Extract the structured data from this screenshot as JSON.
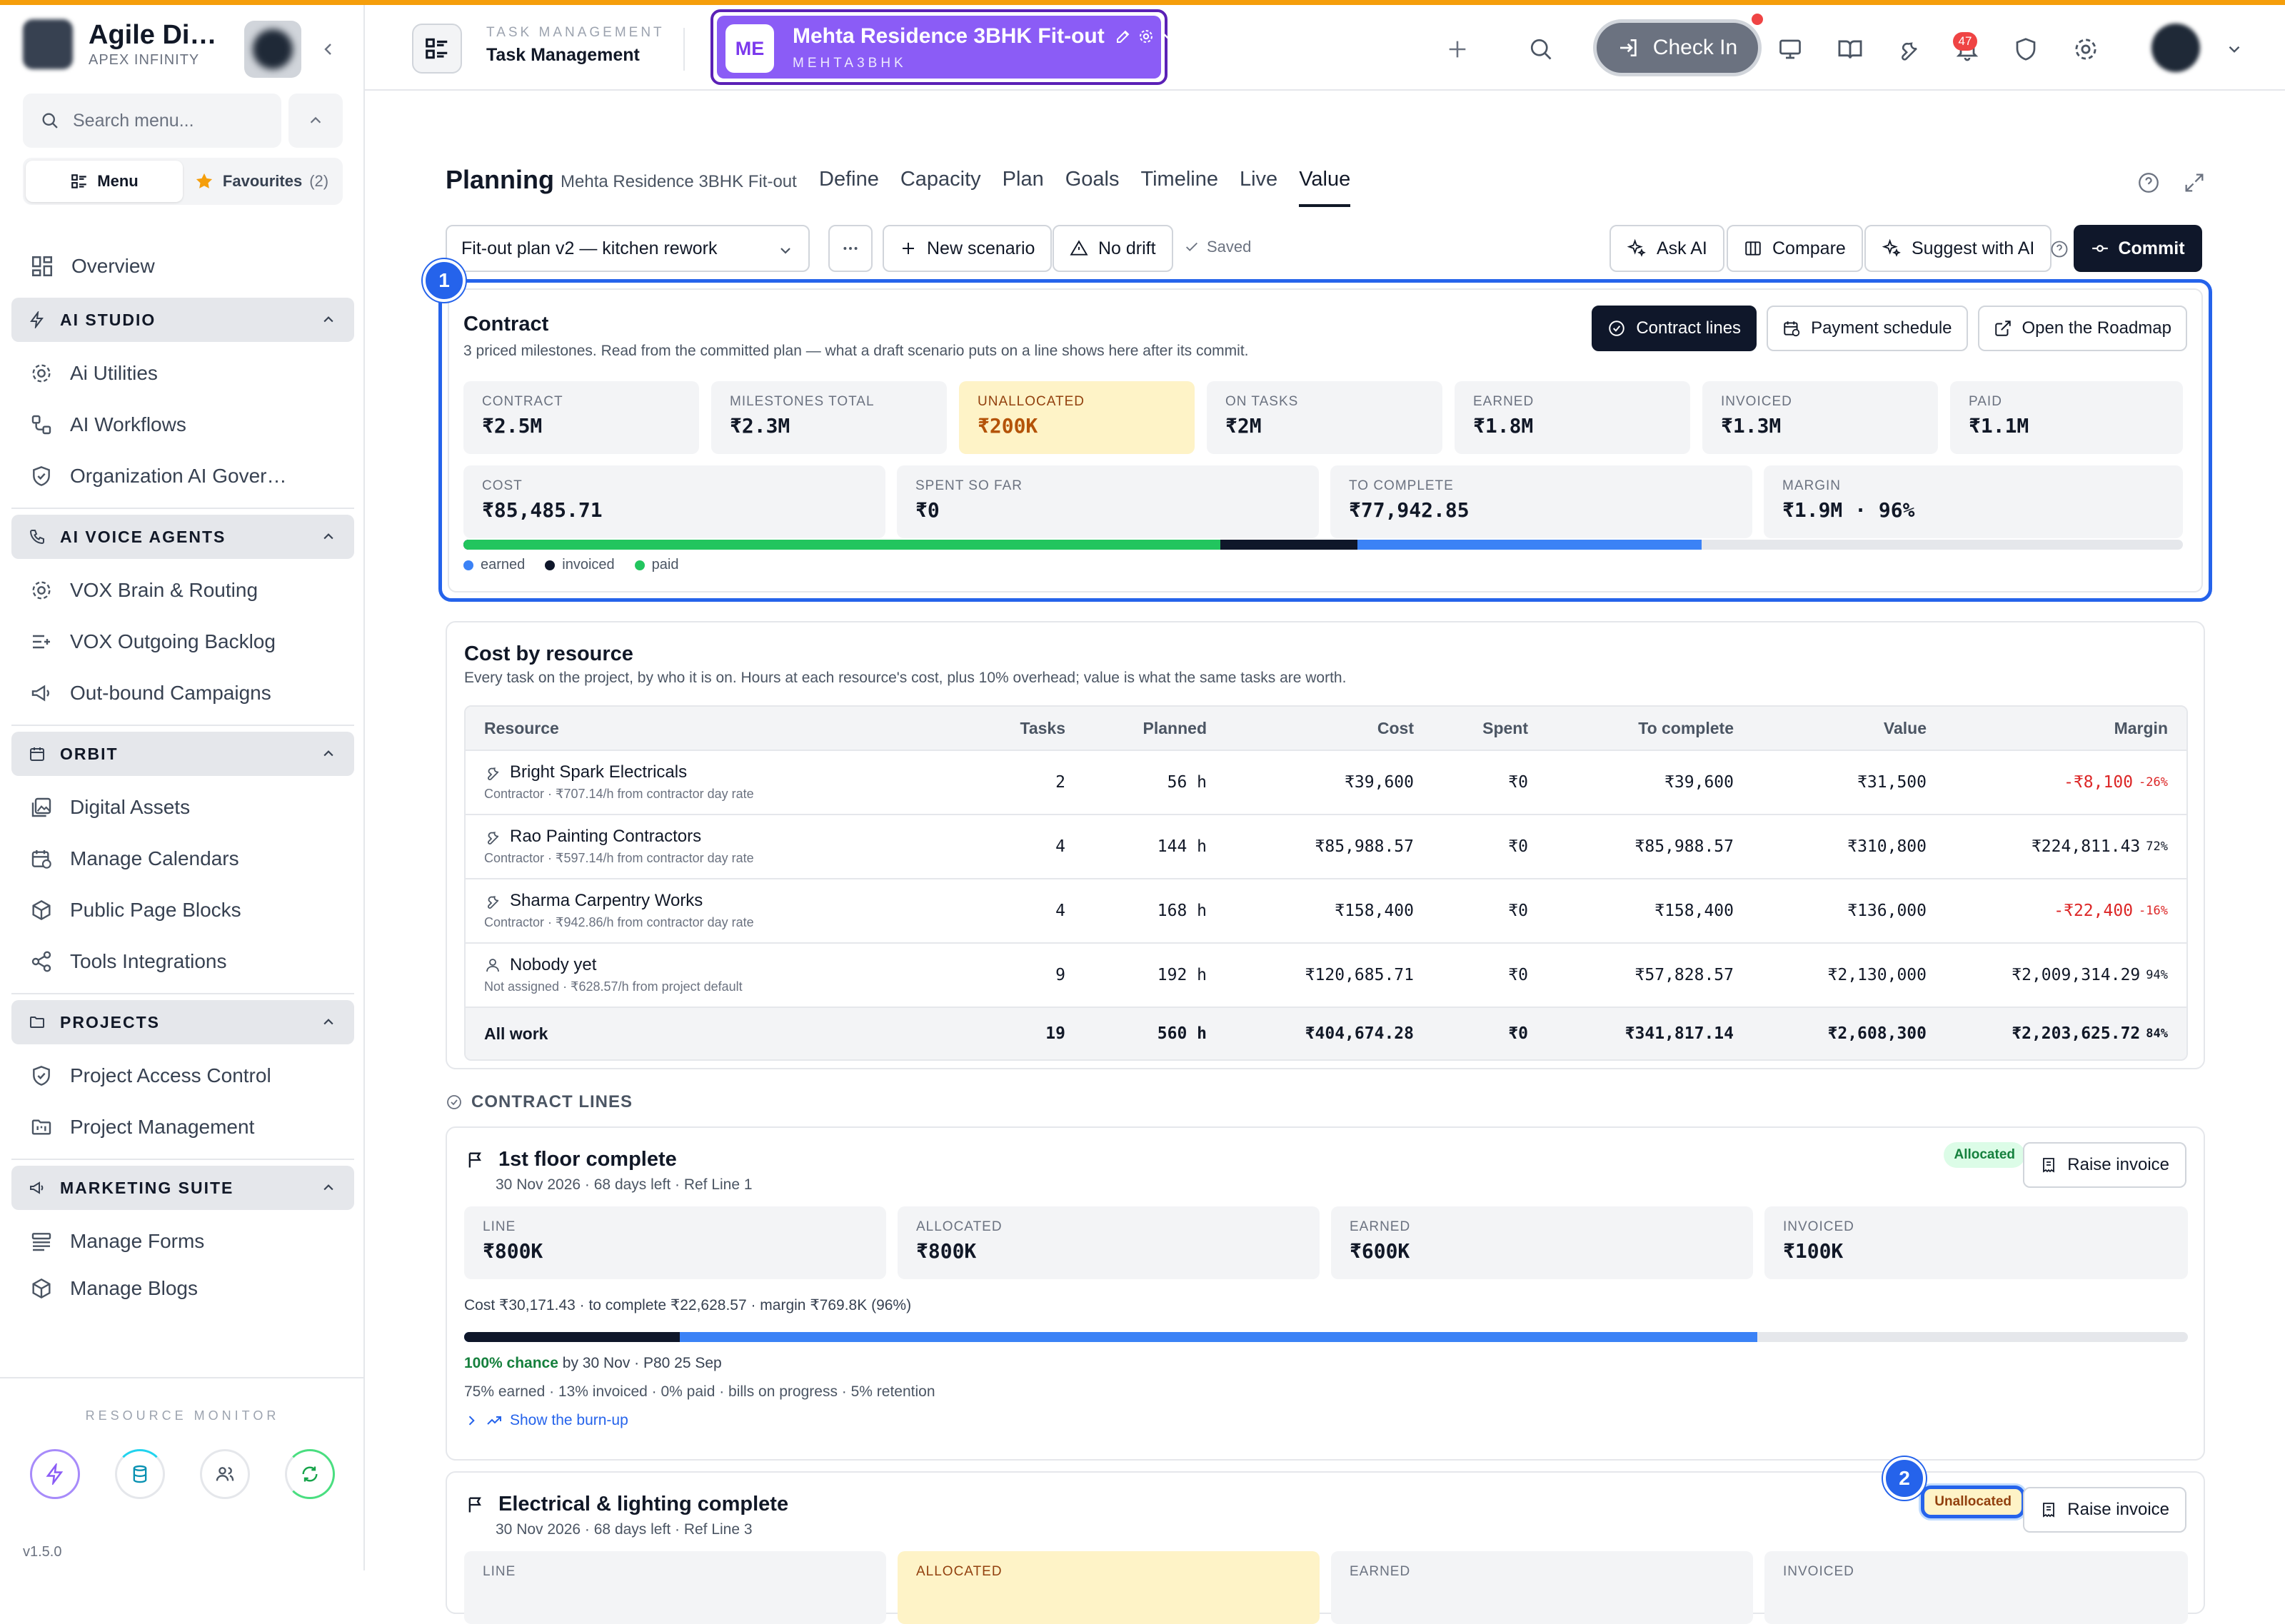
{
  "sidebar": {
    "brand_name": "Agile Di…",
    "brand_sub": "APEX INFINITY",
    "search_placeholder": "Search menu...",
    "menu_tab": "Menu",
    "fav_tab": "Favourites",
    "fav_count": "(2)",
    "overview": "Overview",
    "sections": [
      {
        "title": "AI STUDIO",
        "items": [
          "Ai Utilities",
          "AI Workflows",
          "Organization AI Gover…"
        ]
      },
      {
        "title": "AI VOICE AGENTS",
        "items": [
          "VOX Brain & Routing",
          "VOX Outgoing Backlog",
          "Out-bound Campaigns"
        ]
      },
      {
        "title": "ORBIT",
        "items": [
          "Digital Assets",
          "Manage Calendars",
          "Public Page Blocks",
          "Tools Integrations"
        ]
      },
      {
        "title": "PROJECTS",
        "items": [
          "Project Access Control",
          "Project Management"
        ]
      },
      {
        "title": "MARKETING SUITE",
        "items": [
          "Manage Forms",
          "Manage Blogs"
        ]
      }
    ],
    "resource_monitor": "RESOURCE MONITOR",
    "version": "v1.5.0"
  },
  "header": {
    "module_sub": "TASK MANAGEMENT",
    "module_title": "Task Management",
    "project_badge": "ME",
    "project_name": "Mehta Residence 3BHK Fit-out",
    "project_code": "MEHTA3BHK",
    "check_in": "Check In",
    "notif_count": "47"
  },
  "planning": {
    "title": "Planning",
    "subtitle": "Mehta Residence 3BHK Fit-out",
    "tabs": [
      "Define",
      "Capacity",
      "Plan",
      "Goals",
      "Timeline",
      "Live",
      "Value"
    ],
    "active_tab": "Value",
    "scenario": "Fit-out plan v2 — kitchen rework",
    "new_scenario": "New scenario",
    "no_drift": "No drift",
    "saved": "Saved",
    "ask_ai": "Ask AI",
    "compare": "Compare",
    "suggest": "Suggest with AI",
    "commit": "Commit"
  },
  "contract": {
    "step": "1",
    "title": "Contract",
    "subtitle": "3 priced milestones. Read from the committed plan — what a draft scenario puts on a line shows here after its commit.",
    "btn_lines": "Contract lines",
    "btn_schedule": "Payment schedule",
    "btn_roadmap": "Open the Roadmap",
    "stats_top": [
      {
        "label": "CONTRACT",
        "value": "₹2.5M"
      },
      {
        "label": "MILESTONES TOTAL",
        "value": "₹2.3M"
      },
      {
        "label": "UNALLOCATED",
        "value": "₹200K"
      },
      {
        "label": "ON TASKS",
        "value": "₹2M"
      },
      {
        "label": "EARNED",
        "value": "₹1.8M"
      },
      {
        "label": "INVOICED",
        "value": "₹1.3M"
      },
      {
        "label": "PAID",
        "value": "₹1.1M"
      }
    ],
    "stats_bottom": [
      {
        "label": "COST",
        "value": "₹85,485.71"
      },
      {
        "label": "SPENT SO FAR",
        "value": "₹0"
      },
      {
        "label": "TO COMPLETE",
        "value": "₹77,942.85"
      },
      {
        "label": "MARGIN",
        "value": "₹1.9M · 96%"
      }
    ],
    "progress": {
      "paid": 0.44,
      "invoiced": 0.52,
      "earned": 0.72
    },
    "legend": [
      "earned",
      "invoiced",
      "paid"
    ],
    "colors": {
      "earned": "#3b82f6",
      "invoiced": "#0f172a",
      "paid": "#22c55e"
    }
  },
  "resources": {
    "title": "Cost by resource",
    "subtitle": "Every task on the project, by who it is on. Hours at each resource's cost, plus 10% overhead; value is what the same tasks are worth.",
    "headers": [
      "Resource",
      "Tasks",
      "Planned",
      "Cost",
      "Spent",
      "To complete",
      "Value",
      "Margin"
    ],
    "rows": [
      {
        "name": "Bright Spark Electricals",
        "sub": "Contractor · ₹707.14/h from contractor day rate",
        "tasks": "2",
        "planned": "56 h",
        "cost": "₹39,600",
        "spent": "₹0",
        "complete": "₹39,600",
        "value": "₹31,500",
        "margin": "-₹8,100",
        "pct": "-26%",
        "neg": true,
        "icon": "wrench-icon"
      },
      {
        "name": "Rao Painting Contractors",
        "sub": "Contractor · ₹597.14/h from contractor day rate",
        "tasks": "4",
        "planned": "144 h",
        "cost": "₹85,988.57",
        "spent": "₹0",
        "complete": "₹85,988.57",
        "value": "₹310,800",
        "margin": "₹224,811.43",
        "pct": "72%",
        "neg": false,
        "icon": "wrench-icon"
      },
      {
        "name": "Sharma Carpentry Works",
        "sub": "Contractor · ₹942.86/h from contractor day rate",
        "tasks": "4",
        "planned": "168 h",
        "cost": "₹158,400",
        "spent": "₹0",
        "complete": "₹158,400",
        "value": "₹136,000",
        "margin": "-₹22,400",
        "pct": "-16%",
        "neg": true,
        "icon": "wrench-icon"
      },
      {
        "name": "Nobody yet",
        "sub": "Not assigned · ₹628.57/h from project default",
        "tasks": "9",
        "planned": "192 h",
        "cost": "₹120,685.71",
        "spent": "₹0",
        "complete": "₹57,828.57",
        "value": "₹2,130,000",
        "margin": "₹2,009,314.29",
        "pct": "94%",
        "neg": false,
        "icon": "user-icon"
      }
    ],
    "total": {
      "name": "All work",
      "tasks": "19",
      "planned": "560 h",
      "cost": "₹404,674.28",
      "spent": "₹0",
      "complete": "₹341,817.14",
      "value": "₹2,608,300",
      "margin": "₹2,203,625.72",
      "pct": "84%"
    }
  },
  "contract_lines": {
    "heading": "CONTRACT LINES",
    "lines": [
      {
        "title": "1st floor complete",
        "sub": "30 Nov 2026 · 68 days left · Ref Line 1",
        "status": "Allocated",
        "raise": "Raise invoice",
        "stats": [
          {
            "label": "LINE",
            "value": "₹800K"
          },
          {
            "label": "ALLOCATED",
            "value": "₹800K"
          },
          {
            "label": "EARNED",
            "value": "₹600K"
          },
          {
            "label": "INVOICED",
            "value": "₹100K"
          }
        ],
        "cost_line": "Cost ₹30,171.43 · to complete ₹22,628.57 · margin ₹769.8K (96%)",
        "progress": {
          "invoiced": 0.125,
          "earned": 0.75
        },
        "chance": "100% chance",
        "chance_rest": "by 30 Nov · P80 25 Sep",
        "breakdown": "75% earned · 13% invoiced · 0% paid · bills on progress · 5% retention",
        "burnup": "Show the burn-up"
      },
      {
        "title": "Electrical & lighting complete",
        "sub": "30 Nov 2026 · 68 days left · Ref Line 3",
        "status": "Unallocated",
        "step": "2",
        "raise": "Raise invoice",
        "stats": [
          {
            "label": "LINE",
            "value": ""
          },
          {
            "label": "ALLOCATED",
            "value": ""
          },
          {
            "label": "EARNED",
            "value": ""
          },
          {
            "label": "INVOICED",
            "value": ""
          }
        ]
      }
    ]
  }
}
